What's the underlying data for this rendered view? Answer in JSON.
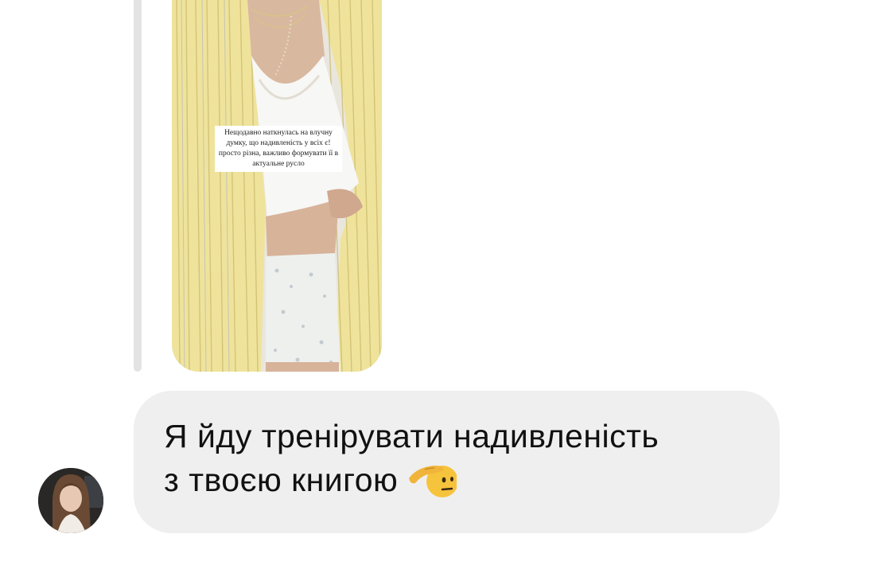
{
  "story_reply": {
    "caption_text": "Нещодавно наткнулась на влучну думку, що надивленість у всіх є! просто різна, важливо формувати її в актуальне русло"
  },
  "message": {
    "line1": "Я йду тренірувати надивленість",
    "line2": "з твоєю книгою",
    "emoji": "saluting-face-emoji"
  },
  "sender": {
    "avatar_icon": "user-avatar"
  },
  "colors": {
    "bubble_bg": "#efefef",
    "reply_bar": "#e3e3e3",
    "text": "#111111",
    "shirt_yellow": "#efe39a"
  }
}
